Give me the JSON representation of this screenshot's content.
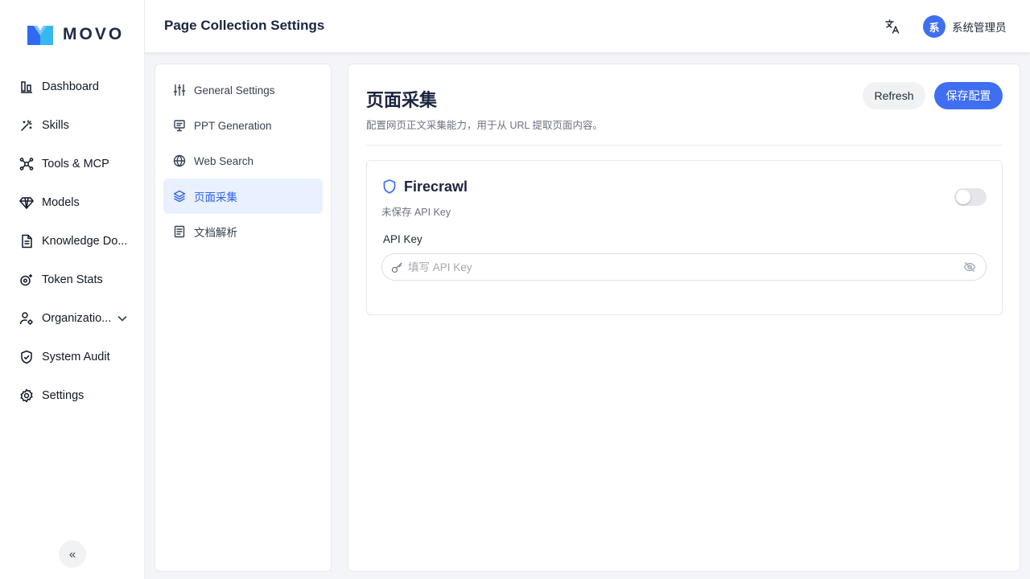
{
  "app": {
    "logo_text": "MOVO",
    "colors": {
      "accent": "#3f6ff0",
      "logo_left": "#2e6bf0",
      "logo_right": "#35b7f0"
    }
  },
  "sidebar": {
    "items": [
      {
        "label": "Dashboard",
        "icon": "bar-chart-icon"
      },
      {
        "label": "Skills",
        "icon": "magic-wand-icon"
      },
      {
        "label": "Tools & MCP",
        "icon": "network-icon"
      },
      {
        "label": "Models",
        "icon": "diamond-icon"
      },
      {
        "label": "Knowledge Do...",
        "icon": "document-icon"
      },
      {
        "label": "Token Stats",
        "icon": "token-icon"
      },
      {
        "label": "Organizatio...",
        "icon": "users-gear-icon"
      },
      {
        "label": "System Audit",
        "icon": "shield-check-icon"
      },
      {
        "label": "Settings",
        "icon": "gear-icon"
      }
    ],
    "collapse_label": "«"
  },
  "header": {
    "title": "Page Collection Settings",
    "user": {
      "avatar_text": "系",
      "name": "系统管理员"
    }
  },
  "subnav": {
    "items": [
      {
        "label": "General Settings",
        "icon": "sliders-icon"
      },
      {
        "label": "PPT Generation",
        "icon": "presentation-icon"
      },
      {
        "label": "Web Search",
        "icon": "globe-icon"
      },
      {
        "label": "页面采集",
        "icon": "layers-icon",
        "active": true
      },
      {
        "label": "文档解析",
        "icon": "document-lines-icon"
      }
    ]
  },
  "main": {
    "title": "页面采集",
    "description": "配置网页正文采集能力，用于从 URL 提取页面内容。",
    "refresh_label": "Refresh",
    "save_label": "保存配置",
    "provider": {
      "name": "Firecrawl",
      "status": "未保存 API Key",
      "enabled": false,
      "field_label": "API Key",
      "placeholder": "填写 API Key",
      "value": ""
    }
  }
}
